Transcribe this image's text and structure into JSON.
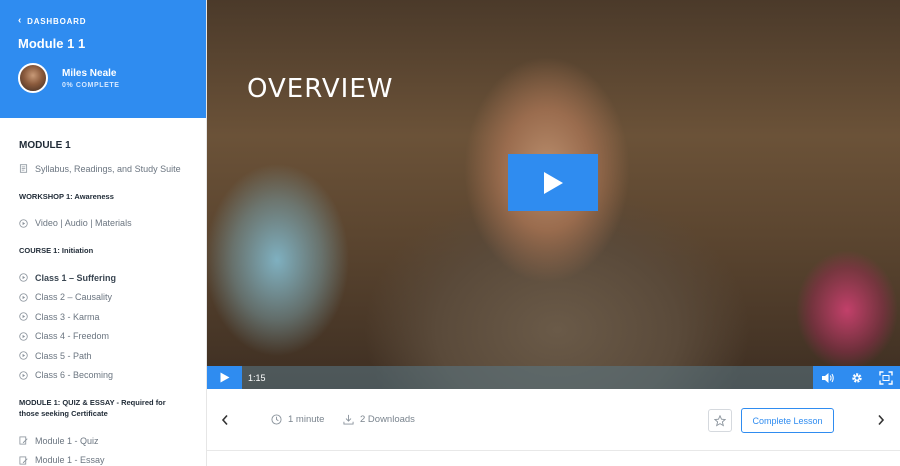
{
  "sidebar": {
    "back_label": "DASHBOARD",
    "course_title": "Module 1 1",
    "instructor_name": "Miles Neale",
    "progress": "0% COMPLETE",
    "sections": {
      "module": "MODULE 1",
      "syllabus": "Syllabus, Readings, and Study Suite",
      "workshop": "WORKSHOP 1: Awareness",
      "workshop_item": "Video | Audio | Materials",
      "course": "COURSE 1: Initiation",
      "classes": [
        "Class 1 – Suffering",
        "Class 2 – Causality",
        "Class 3 - Karma",
        "Class 4 - Freedom",
        "Class 5 - Path",
        "Class 6 - Becoming"
      ],
      "quiz_section": "MODULE 1: QUIZ & ESSAY - Required for those seeking Certificate",
      "quiz_items": [
        "Module 1 - Quiz",
        "Module 1 - Essay"
      ]
    }
  },
  "video": {
    "overlay_title": "OVERVIEW",
    "time": "1:15"
  },
  "lesson_bar": {
    "duration": "1 minute",
    "downloads": "2 Downloads",
    "complete_label": "Complete Lesson"
  },
  "colors": {
    "accent": "#2f8cf0"
  }
}
